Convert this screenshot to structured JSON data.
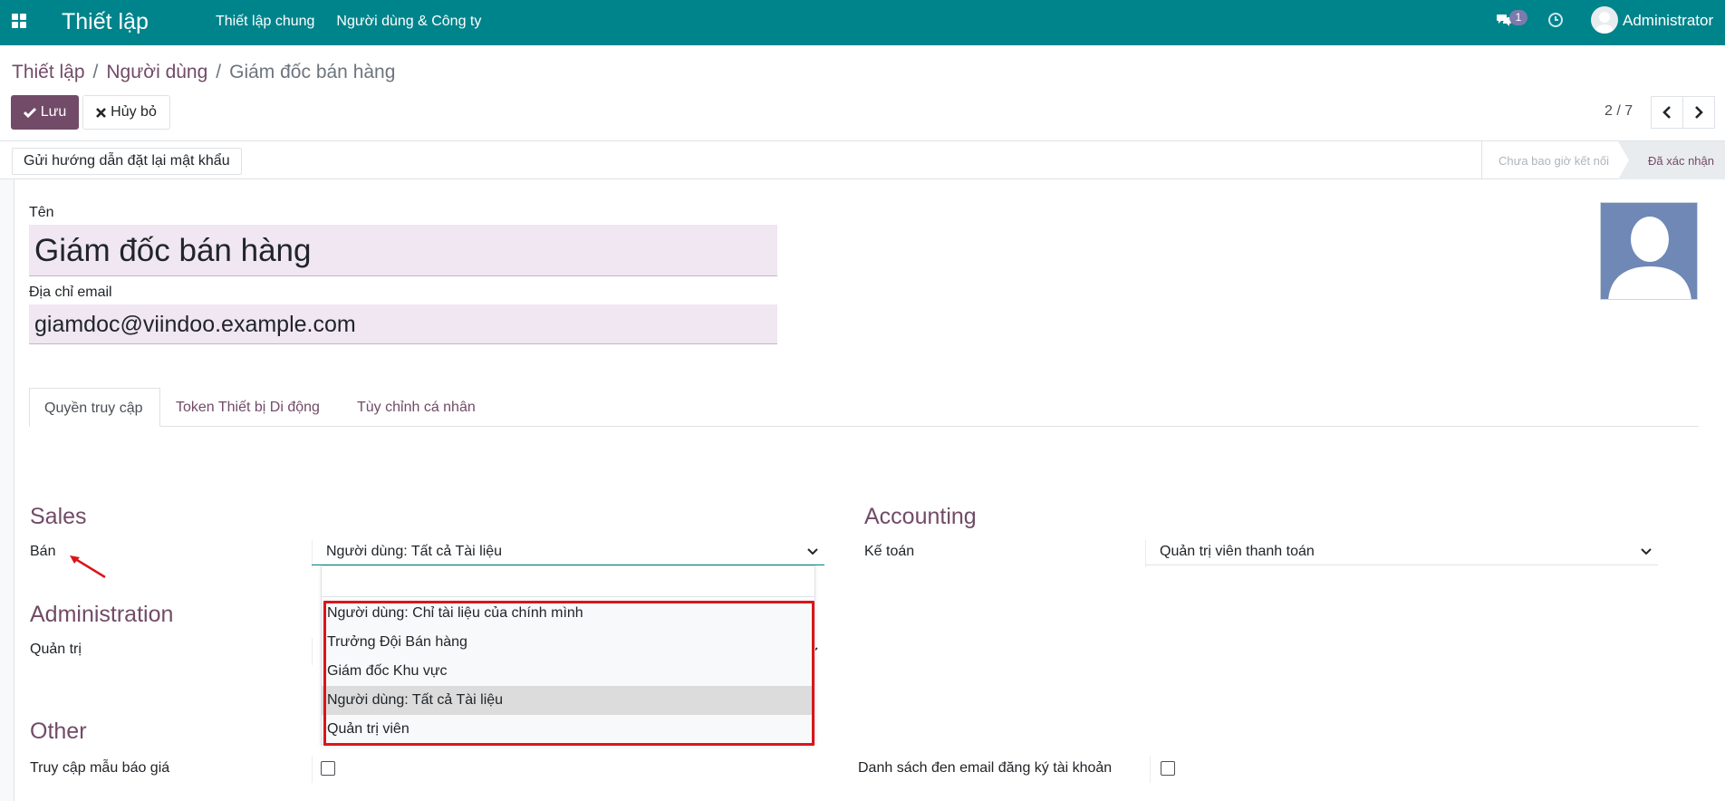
{
  "navbar": {
    "app_title": "Thiết lập",
    "menu": [
      "Thiết lập chung",
      "Người dùng & Công ty"
    ],
    "message_count": "1",
    "user_name": "Administrator",
    "bg_color": "#00848c"
  },
  "breadcrumb": {
    "root": "Thiết lập",
    "sep1": "/",
    "parent": "Người dùng",
    "sep2": "/",
    "current": "Giám đốc bán hàng"
  },
  "actions": {
    "save_label": "Lưu",
    "discard_label": "Hủy bỏ"
  },
  "pager": {
    "value": "2 / 7"
  },
  "statusbar": {
    "reset_button": "Gửi hướng dẫn đặt lại mật khẩu",
    "stage_never": "Chưa bao giờ kết nối",
    "stage_confirmed": "Đã xác nhận"
  },
  "form": {
    "name_label": "Tên",
    "name_value": "Giám đốc bán hàng",
    "email_label": "Địa chỉ email",
    "email_value": "giamdoc@viindoo.example.com"
  },
  "tabs": [
    "Quyền truy cập",
    "Token Thiết bị Di động",
    "Tùy chỉnh cá nhân"
  ],
  "sections": {
    "sales": {
      "title": "Sales",
      "label": "Bán",
      "value": "Người dùng: Tất cả Tài liệu"
    },
    "accounting": {
      "title": "Accounting",
      "label": "Kế toán",
      "value": "Quản trị viên thanh toán"
    },
    "administration": {
      "title": "Administration",
      "label": "Quản trị"
    },
    "other": {
      "title": "Other",
      "label_left": "Truy cập mẫu báo giá",
      "label_right": "Danh sách đen email đăng ký tài khoản"
    }
  },
  "dropdown": {
    "options": [
      "Người dùng: Chỉ tài liệu của chính mình",
      "Trưởng Đội Bán hàng",
      "Giám đốc Khu vực",
      "Người dùng: Tất cả Tài liệu",
      "Quản trị viên"
    ],
    "highlighted": "Người dùng: Tất cả Tài liệu"
  },
  "colors": {
    "accent": "#714b67",
    "annotation": "#d9161b"
  }
}
